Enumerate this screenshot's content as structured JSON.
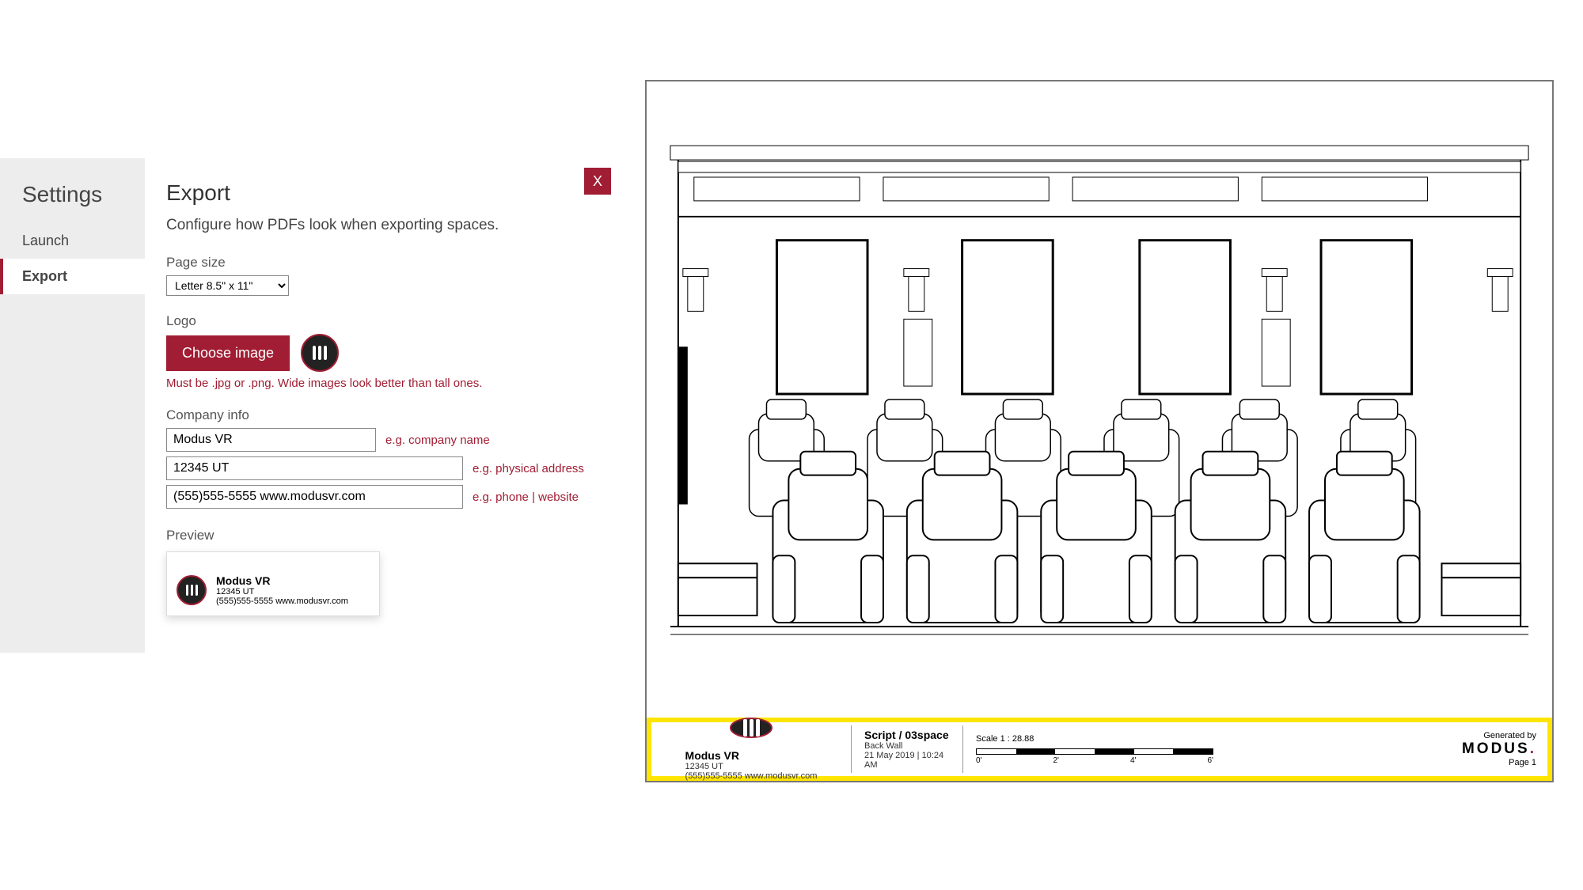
{
  "sidebar": {
    "title": "Settings",
    "items": [
      {
        "label": "Launch",
        "active": false
      },
      {
        "label": "Export",
        "active": true
      }
    ]
  },
  "content": {
    "title": "Export",
    "subtitle": "Configure how PDFs look when exporting spaces.",
    "close_label": "X",
    "page_size": {
      "label": "Page size",
      "value": "Letter 8.5\" x 11\""
    },
    "logo": {
      "label": "Logo",
      "choose_label": "Choose image",
      "hint": "Must be .jpg or .png. Wide images look better than tall ones."
    },
    "company": {
      "label": "Company info",
      "rows": [
        {
          "value": "Modus VR",
          "example": "e.g. company name"
        },
        {
          "value": "12345 UT",
          "example": "e.g. physical address"
        },
        {
          "value": "(555)555-5555 www.modusvr.com",
          "example": "e.g. phone | website"
        }
      ]
    },
    "preview": {
      "label": "Preview",
      "name": "Modus VR",
      "addr": "12345 UT",
      "contact": "(555)555-5555 www.modusvr.com"
    }
  },
  "footer": {
    "company": {
      "name": "Modus VR",
      "addr": "12345 UT",
      "contact": "(555)555-5555 www.modusvr.com"
    },
    "script": {
      "title": "Script / 03space",
      "wall": "Back Wall",
      "date": "21 May 2019 | 10:24 AM"
    },
    "scale": {
      "label": "Scale 1 : 28.88",
      "ticks": [
        "0'",
        "2'",
        "4'",
        "6'"
      ]
    },
    "right": {
      "generated": "Generated by",
      "brand_pre": "MODUS",
      "brand_suffix": ".",
      "page": "Page 1"
    }
  }
}
